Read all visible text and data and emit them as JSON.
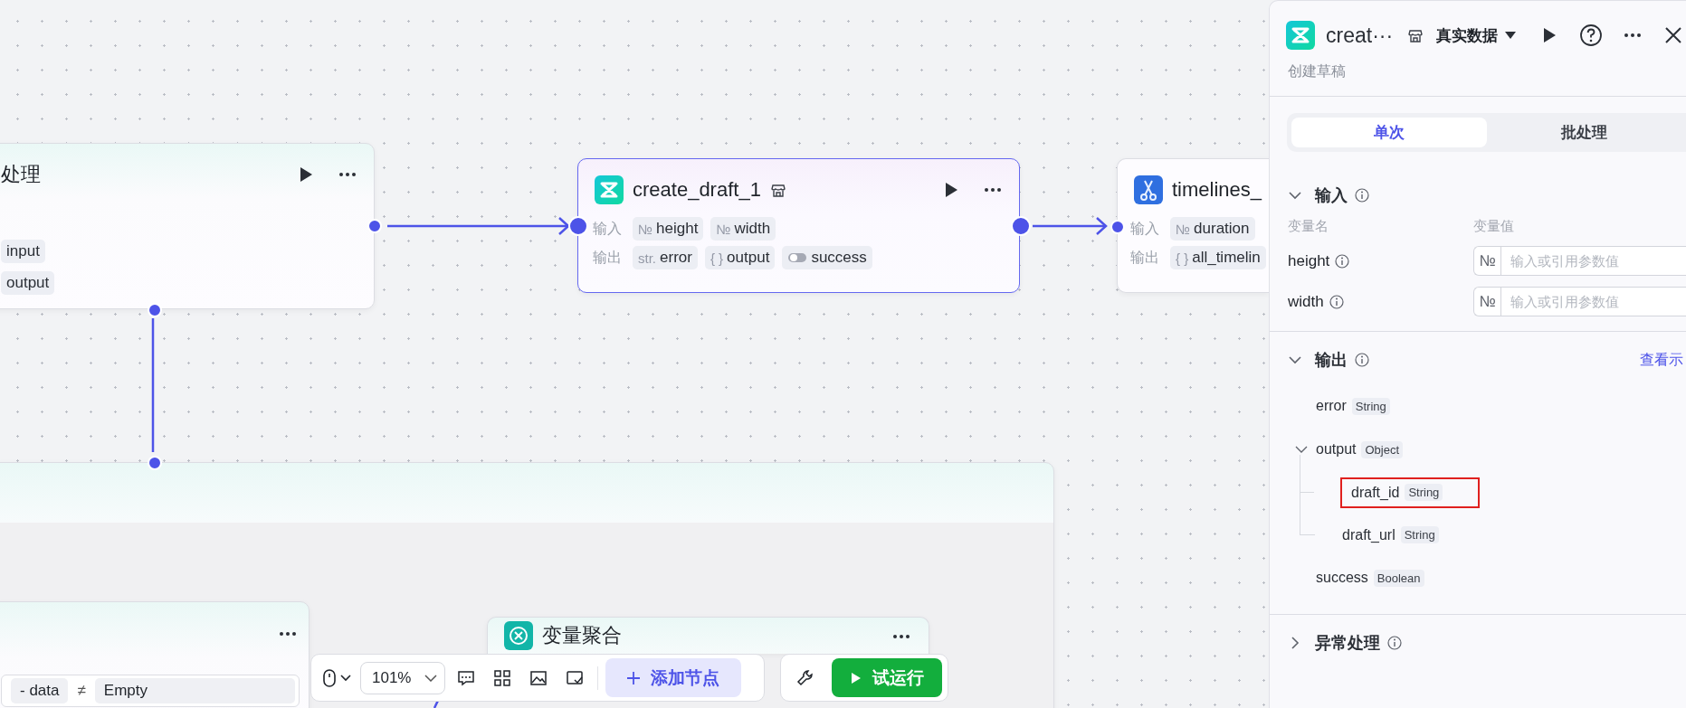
{
  "canvas": {
    "nodes": [
      {
        "kind": "batch",
        "title": "处理",
        "selected": false,
        "rows": [
          {
            "tags": [
              {
                "kind": "plain",
                "name": "input"
              }
            ]
          },
          {
            "tags": [
              {
                "kind": "plain",
                "name": "output"
              }
            ]
          }
        ]
      },
      {
        "kind": "plugin",
        "title": "create_draft_1",
        "selected": true,
        "rows": [
          {
            "label": "输入",
            "tags": [
              {
                "kind": "text",
                "icon": "№",
                "name": "height"
              },
              {
                "kind": "text",
                "icon": "№",
                "name": "width"
              }
            ]
          },
          {
            "label": "输出",
            "tags": [
              {
                "kind": "text",
                "icon": "str.",
                "name": "error"
              },
              {
                "kind": "text",
                "icon": "{ }",
                "name": "output"
              },
              {
                "kind": "toggle",
                "name": "success"
              }
            ]
          }
        ]
      },
      {
        "kind": "plugin",
        "title": "timelines_",
        "selected": false,
        "rows": [
          {
            "label": "输入",
            "tags": [
              {
                "kind": "text",
                "icon": "№",
                "name": "duration"
              }
            ]
          },
          {
            "label": "输出",
            "tags": [
              {
                "kind": "text",
                "icon": "{ }",
                "name": "all_timelin"
              }
            ]
          }
        ]
      },
      {
        "kind": "group"
      },
      {
        "kind": "condition",
        "clause": {
          "prefix": "-",
          "left": "data",
          "operator": "≠",
          "right": "Empty"
        }
      },
      {
        "kind": "aggregate",
        "title": "变量聚合"
      }
    ]
  },
  "toolbar": {
    "zoom": "101%",
    "add_node": "添加节点",
    "run": "试运行"
  },
  "panel": {
    "title": "creat···",
    "data_source": "真实数据",
    "subtitle": "创建草稿",
    "tabs": [
      {
        "label": "单次",
        "selected": true
      },
      {
        "label": "批处理",
        "selected": false
      }
    ],
    "sections": [
      {
        "kind": "input",
        "title": "输入",
        "expanded": true,
        "name_header": "变量名",
        "value_header": "变量值",
        "params": [
          {
            "name": "height",
            "type": "№",
            "placeholder": "输入或引用参数值"
          },
          {
            "name": "width",
            "type": "№",
            "placeholder": "输入或引用参数值"
          }
        ]
      },
      {
        "kind": "output",
        "title": "输出",
        "expanded": true,
        "link": "查看示",
        "fields": [
          {
            "name": "error",
            "type": "String"
          },
          {
            "name": "output",
            "type": "Object",
            "expanded": true,
            "children": [
              {
                "name": "draft_id",
                "type": "String",
                "highlighted": true
              },
              {
                "name": "draft_url",
                "type": "String"
              }
            ]
          },
          {
            "name": "success",
            "type": "Boolean"
          }
        ]
      },
      {
        "kind": "exception",
        "title": "异常处理",
        "expanded": false
      }
    ]
  }
}
